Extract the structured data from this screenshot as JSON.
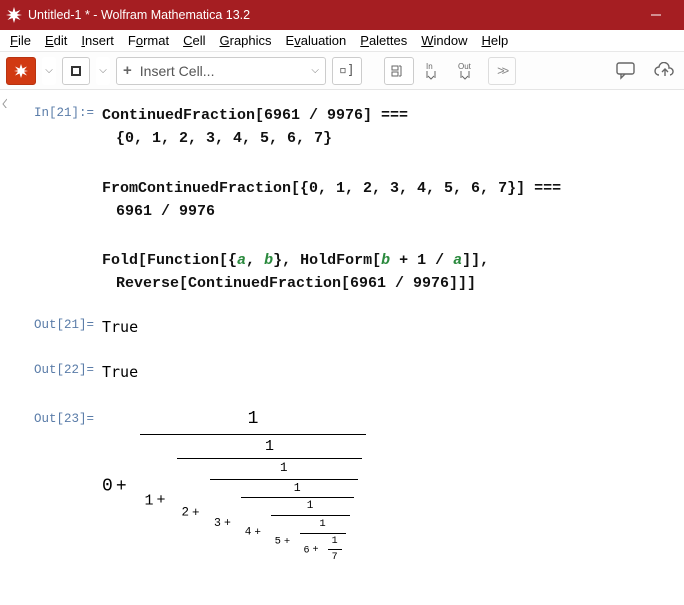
{
  "window": {
    "title": "Untitled-1 * - Wolfram Mathematica 13.2"
  },
  "menu": {
    "file": "File",
    "edit": "Edit",
    "insert": "Insert",
    "format": "Format",
    "cell": "Cell",
    "graphics": "Graphics",
    "evaluation": "Evaluation",
    "palettes": "Palettes",
    "window": "Window",
    "help": "Help"
  },
  "toolbar": {
    "insert_cell": "Insert Cell...",
    "in_label": "In",
    "out_label": "Out"
  },
  "cells": {
    "in21_label": "In[21]:=",
    "out21_label": "Out[21]=",
    "out22_label": "Out[22]=",
    "out23_label": "Out[23]=",
    "line1a": "ContinuedFraction[6961 / 9976] ===",
    "line1b": "{0, 1, 2, 3, 4, 5, 6, 7}",
    "line2a": "FromContinuedFraction[{0, 1, 2, 3, 4, 5, 6, 7}] ===",
    "line2b": "6961 / 9976",
    "fold_pre": "Fold[Function[{",
    "fold_a": "a",
    "fold_sep": ", ",
    "fold_b": "b",
    "fold_mid": "}, HoldForm[",
    "fold_b2": "b",
    "fold_plus": " + 1 / ",
    "fold_a2": "a",
    "fold_end": "]],",
    "fold_line2": "Reverse[ContinuedFraction[6961 / 9976]]]",
    "out21": "True",
    "out22": "True",
    "cf": {
      "vals": [
        "0",
        "1",
        "2",
        "3",
        "4",
        "5",
        "6",
        "7"
      ],
      "num": "1"
    }
  }
}
